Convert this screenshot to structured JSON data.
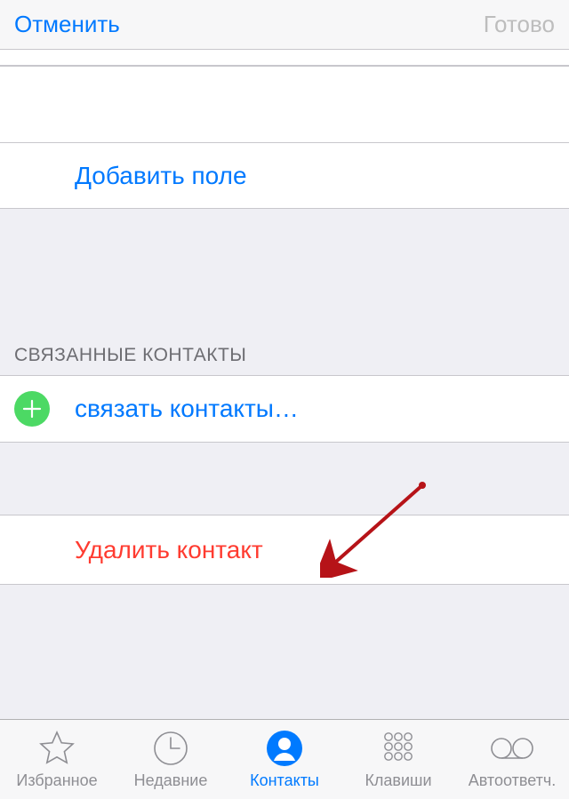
{
  "header": {
    "cancel_label": "Отменить",
    "done_label": "Готово"
  },
  "add_field_label": "Добавить поле",
  "linked_section_title": "СВЯЗАННЫЕ КОНТАКТЫ",
  "link_contacts_label": "связать контакты…",
  "delete_contact_label": "Удалить контакт",
  "tabs": {
    "favorites": "Избранное",
    "recents": "Недавние",
    "contacts": "Контакты",
    "keypad": "Клавиши",
    "voicemail": "Автоответч."
  }
}
